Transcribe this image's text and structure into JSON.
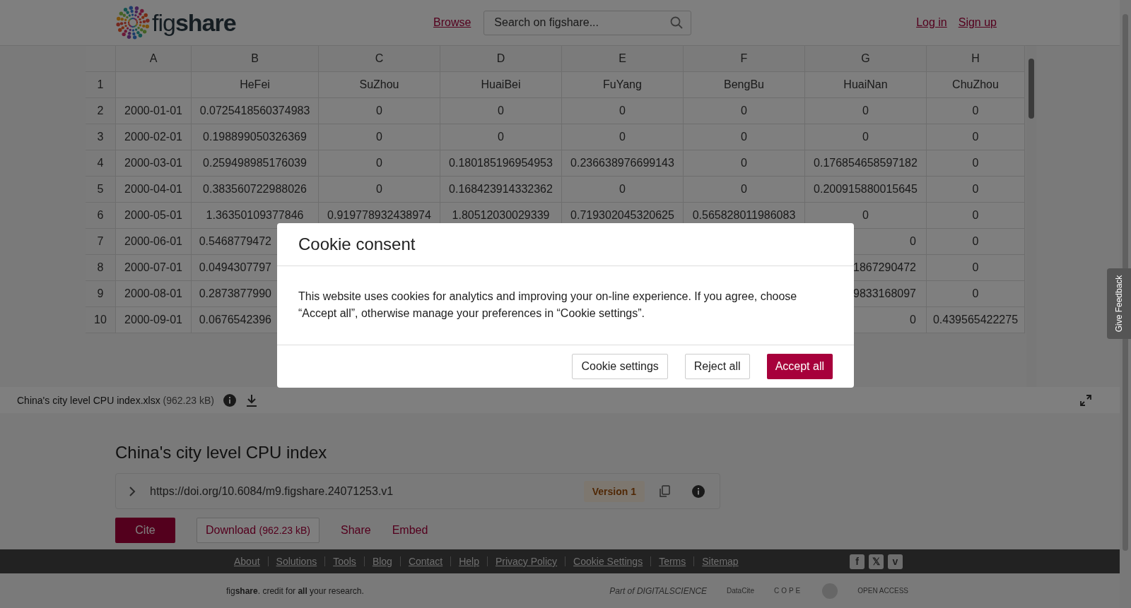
{
  "header": {
    "logo": "fig**share**",
    "nav": [
      {
        "label": "Browse"
      }
    ],
    "search": {
      "placeholder": "Search on figshare..."
    },
    "auth": [
      {
        "label": "Log in"
      },
      {
        "label": "Sign up"
      }
    ]
  },
  "preview": {
    "columns": [
      "A",
      "B",
      "C",
      "D",
      "E",
      "F",
      "G",
      "H"
    ],
    "rows": [
      {
        "num": "1",
        "kind": "plain",
        "cells": [
          null,
          "HeFei",
          "SuZhou",
          "HuaiBei",
          "FuYang",
          "BengBu",
          "HuaiNan",
          "ChuZhou"
        ]
      },
      {
        "num": "2",
        "kind": "plain",
        "cells": [
          "2000-01-01",
          "0.0725418560374983",
          "0",
          "0",
          "0",
          "0",
          "0",
          "0"
        ]
      },
      {
        "num": "3",
        "kind": "plain",
        "cells": [
          "2000-02-01",
          "0.198899050326369",
          "0",
          "0",
          "0",
          "0",
          "0",
          "0"
        ]
      },
      {
        "num": "4",
        "kind": "plain",
        "cells": [
          "2000-03-01",
          "0.259498985176039",
          "0",
          "0.180185196954953",
          "0.236638976699143",
          "0",
          "0.176854658597182",
          "0"
        ]
      },
      {
        "num": "5",
        "kind": "plain",
        "cells": [
          "2000-04-01",
          "0.383560722988026",
          "0",
          "0.168423914332362",
          "0",
          "0",
          "0.200915880015645",
          "0"
        ]
      },
      {
        "num": "6",
        "kind": "plain",
        "cells": [
          "2000-05-01",
          "1.36350109377846",
          "0.919778932438974",
          "1.80512030029339",
          "0.719302045320625",
          "0.565828011986083",
          "0",
          "0"
        ]
      },
      {
        "num": "7",
        "kind": "covered",
        "cells": [
          "2000-06-01",
          "0.5468779472",
          null,
          null,
          null,
          null,
          "0",
          "0"
        ]
      },
      {
        "num": "8",
        "kind": "covered",
        "cells": [
          "2000-07-01",
          "0.0494307797",
          null,
          null,
          null,
          null,
          "1867290472",
          "0"
        ]
      },
      {
        "num": "9",
        "kind": "covered",
        "cells": [
          "2000-08-01",
          "0.2873877990",
          null,
          null,
          null,
          null,
          "9833168097",
          "0"
        ]
      },
      {
        "num": "10",
        "kind": "covered",
        "cells": [
          "2000-09-01",
          "0.0676542396",
          null,
          null,
          null,
          null,
          "0",
          "0.439565422275"
        ]
      }
    ]
  },
  "file_bar": {
    "name": "China's city level CPU index.xlsx",
    "size": "(962.23 kB)"
  },
  "item": {
    "title": "China's city level CPU index",
    "doi": "https://doi.org/10.6084/m9.figshare.24071253.v1",
    "version": "Version 1",
    "actions": [
      {
        "kind": "primary",
        "label": "Cite"
      },
      {
        "kind": "outline",
        "label": "Download",
        "extra": "(962.23 kB)"
      },
      {
        "kind": "link",
        "label": "Share"
      },
      {
        "kind": "link",
        "label": "Embed"
      }
    ]
  },
  "footer": {
    "links": [
      "About",
      "Solutions",
      "Tools",
      "Blog",
      "Contact",
      "Help",
      "Privacy Policy",
      "Cookie Settings",
      "Terms",
      "Sitemap"
    ],
    "social": [
      "f",
      "𝕏",
      "v"
    ],
    "tagline": "fig**share**. credit for **all** your research.",
    "partners": [
      {
        "kind": "ds",
        "label": "Part of DIGITALSCIENCE"
      },
      {
        "kind": "datacite",
        "label": "DataCite"
      },
      {
        "kind": "cope",
        "label": "COPE"
      },
      {
        "kind": "badge"
      },
      {
        "kind": "oa",
        "label": "OPEN ACCESS"
      }
    ]
  },
  "feedback": "Give Feedback",
  "cookie_modal": {
    "title": "Cookie consent",
    "body": "This website uses cookies for analytics and improving your on-line experience. If you agree, choose “Accept all”, otherwise manage your preferences in “Cookie settings”.",
    "buttons": [
      {
        "kind": "outline",
        "label": "Cookie settings"
      },
      {
        "kind": "outline",
        "label": "Reject all"
      },
      {
        "kind": "primary",
        "label": "Accept all"
      }
    ]
  }
}
